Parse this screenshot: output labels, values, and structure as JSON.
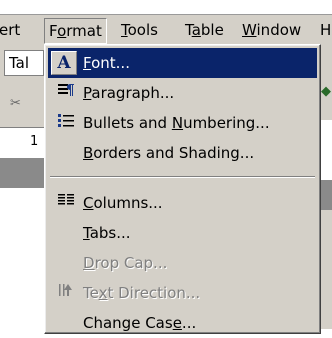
{
  "menubar": {
    "items": [
      {
        "label": "ert"
      },
      {
        "label": "Format",
        "active": true
      },
      {
        "label": "Tools"
      },
      {
        "label": "Table"
      },
      {
        "label": "Window"
      },
      {
        "label": "H"
      }
    ]
  },
  "toolbar": {
    "style_box_value": "Tal",
    "ruler_number": "1"
  },
  "format_menu": {
    "items": [
      {
        "label": "Font...",
        "icon": "font-a-icon",
        "highlighted": true,
        "enabled": true
      },
      {
        "label": "Paragraph...",
        "icon": "paragraph-icon",
        "enabled": true
      },
      {
        "label": "Bullets and Numbering...",
        "icon": "bullets-icon",
        "enabled": true
      },
      {
        "label": "Borders and Shading...",
        "icon": "",
        "enabled": true
      },
      {
        "label": "Columns...",
        "icon": "columns-icon",
        "enabled": true
      },
      {
        "label": "Tabs...",
        "icon": "",
        "enabled": true
      },
      {
        "label": "Drop Cap...",
        "icon": "",
        "enabled": false
      },
      {
        "label": "Text Direction...",
        "icon": "text-direction-icon",
        "enabled": false
      },
      {
        "label": "Change Case...",
        "icon": "",
        "enabled": true
      }
    ]
  },
  "colors": {
    "menu_face": "#d4d0c8",
    "highlight": "#0a246a",
    "disabled_text": "#808080"
  }
}
